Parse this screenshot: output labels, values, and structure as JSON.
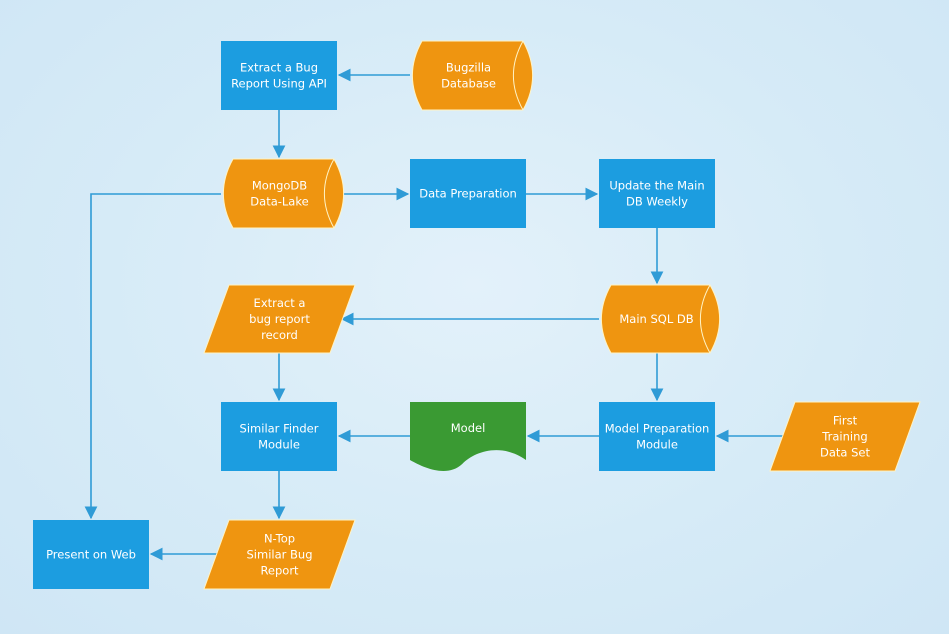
{
  "diagram": {
    "type": "flowchart",
    "colors": {
      "process": "#1c9de0",
      "data_store": "#ef9510",
      "io": "#ef9510",
      "document": "#3a9a33",
      "edge": "#2f9bd6",
      "text": "#ffffff"
    },
    "nodes": [
      {
        "id": "extract_api",
        "shape": "process",
        "lines": [
          "Extract a Bug",
          "Report Using API"
        ]
      },
      {
        "id": "bugzilla",
        "shape": "data_store",
        "lines": [
          "Bugzilla",
          "Database"
        ]
      },
      {
        "id": "mongodb",
        "shape": "data_store",
        "lines": [
          "MongoDB",
          "Data-Lake"
        ]
      },
      {
        "id": "data_prep",
        "shape": "process",
        "lines": [
          "Data Preparation"
        ]
      },
      {
        "id": "update_main",
        "shape": "process",
        "lines": [
          "Update the Main",
          "DB Weekly"
        ]
      },
      {
        "id": "extract_record",
        "shape": "io",
        "lines": [
          "Extract a",
          "bug report",
          "record"
        ]
      },
      {
        "id": "main_sql",
        "shape": "data_store",
        "lines": [
          "Main SQL DB"
        ]
      },
      {
        "id": "similar_finder",
        "shape": "process",
        "lines": [
          "Similar Finder",
          "Module"
        ]
      },
      {
        "id": "model",
        "shape": "document",
        "lines": [
          "Model"
        ]
      },
      {
        "id": "model_prep",
        "shape": "process",
        "lines": [
          "Model Preparation",
          "Module"
        ]
      },
      {
        "id": "first_training",
        "shape": "io",
        "lines": [
          "First",
          "Training",
          "Data Set"
        ]
      },
      {
        "id": "present_web",
        "shape": "process",
        "lines": [
          "Present on Web"
        ]
      },
      {
        "id": "ntop",
        "shape": "io",
        "lines": [
          "N-Top",
          "Similar Bug",
          "Report"
        ]
      }
    ],
    "edges": [
      {
        "from": "bugzilla",
        "to": "extract_api"
      },
      {
        "from": "extract_api",
        "to": "mongodb"
      },
      {
        "from": "mongodb",
        "to": "data_prep"
      },
      {
        "from": "data_prep",
        "to": "update_main"
      },
      {
        "from": "update_main",
        "to": "main_sql"
      },
      {
        "from": "main_sql",
        "to": "extract_record"
      },
      {
        "from": "main_sql",
        "to": "model_prep"
      },
      {
        "from": "extract_record",
        "to": "similar_finder"
      },
      {
        "from": "first_training",
        "to": "model_prep"
      },
      {
        "from": "model_prep",
        "to": "model"
      },
      {
        "from": "model",
        "to": "similar_finder"
      },
      {
        "from": "similar_finder",
        "to": "ntop"
      },
      {
        "from": "ntop",
        "to": "present_web"
      },
      {
        "from": "mongodb",
        "to": "present_web"
      }
    ]
  }
}
